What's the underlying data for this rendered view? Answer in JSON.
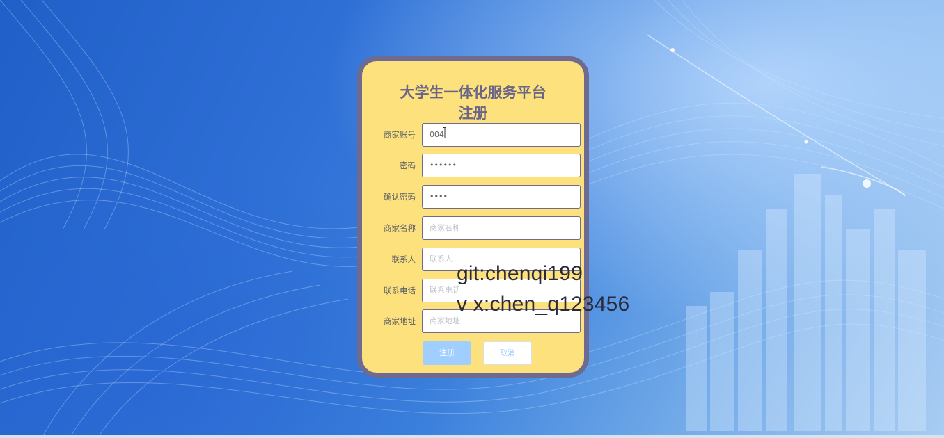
{
  "form": {
    "title_line1": "大学生一体化服务平台",
    "title_line2": "注册",
    "fields": [
      {
        "label": "商家账号",
        "value": "004",
        "placeholder": ""
      },
      {
        "label": "密码",
        "value": "••••••",
        "placeholder": ""
      },
      {
        "label": "确认密码",
        "value": "••••",
        "placeholder": ""
      },
      {
        "label": "商家名称",
        "value": "",
        "placeholder": "商家名称"
      },
      {
        "label": "联系人",
        "value": "",
        "placeholder": "联系人"
      },
      {
        "label": "联系电话",
        "value": "",
        "placeholder": "联系电话"
      },
      {
        "label": "商家地址",
        "value": "",
        "placeholder": "商家地址"
      }
    ],
    "register_label": "注册",
    "cancel_label": "取消"
  },
  "watermark": {
    "line1": "git:chenqi199",
    "line2": "v x:chen_q123456"
  }
}
